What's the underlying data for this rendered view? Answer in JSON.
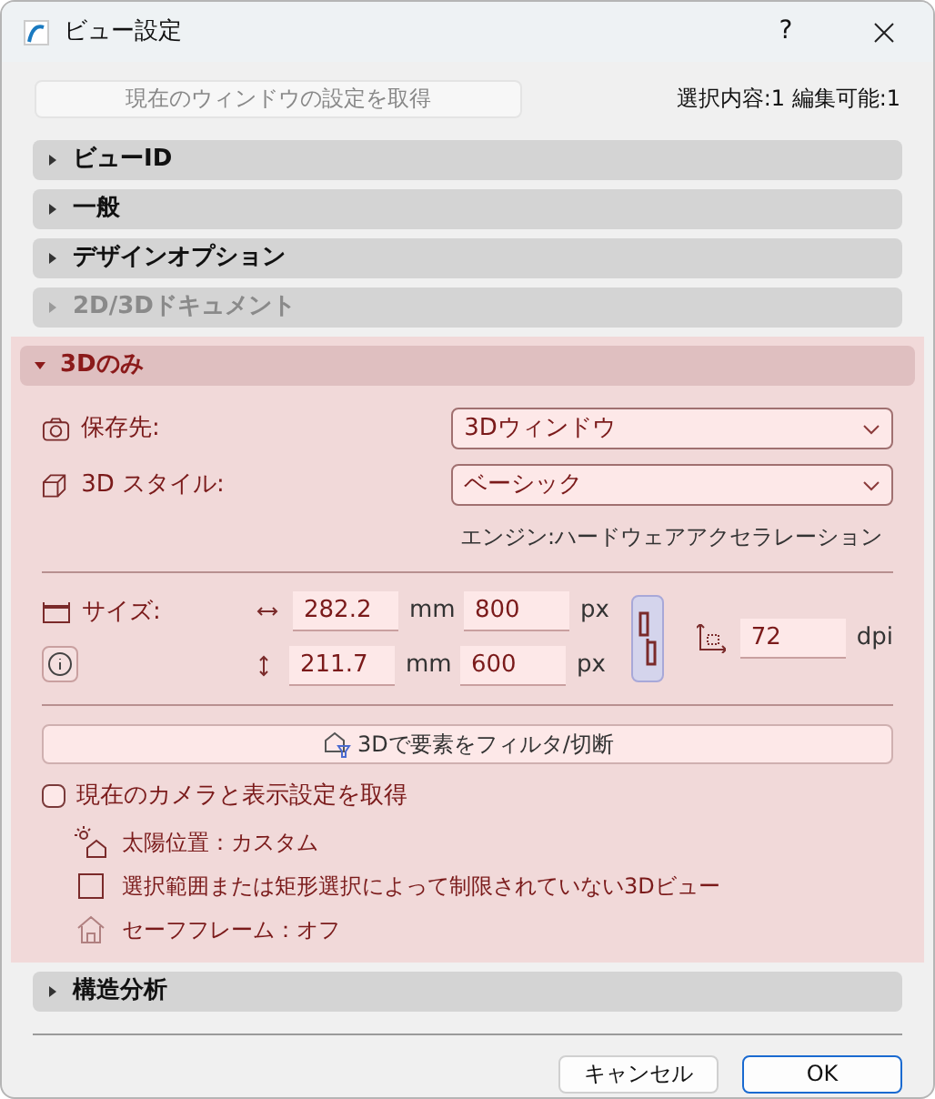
{
  "window": {
    "title": "ビュー設定",
    "help": "?"
  },
  "get_window_button": {
    "label": "現在のウィンドウの設定を取得",
    "disabled": true
  },
  "selection_info": "選択内容:1 編集可能:1",
  "sections": [
    {
      "label": "ビューID",
      "expanded": false,
      "disabled": false
    },
    {
      "label": "一般",
      "expanded": false,
      "disabled": false
    },
    {
      "label": "デザインオプション",
      "expanded": false,
      "disabled": false
    },
    {
      "label": "2D/3Dドキュメント",
      "expanded": false,
      "disabled": true
    },
    {
      "label": "3Dのみ",
      "expanded": true,
      "disabled": false,
      "content": {
        "save_to": {
          "label": "保存先:",
          "value": "3Dウィンドウ"
        },
        "style": {
          "label": "3D スタイル:",
          "value": "ベーシック"
        },
        "engine": "エンジン:ハードウェアアクセラレーション",
        "size": {
          "label": "サイズ:",
          "rows": [
            {
              "mm": "282.2",
              "mm_unit": "mm",
              "px": "800",
              "px_unit": "px"
            },
            {
              "mm": "211.7",
              "mm_unit": "mm",
              "px": "600",
              "px_unit": "px"
            }
          ],
          "linked": true,
          "dpi": "72",
          "dpi_unit": "dpi"
        },
        "filter_button": "3Dで要素をフィルタ/切断",
        "camera_checkbox": {
          "label": "現在のカメラと表示設定を取得",
          "checked": false
        },
        "info_lines": [
          {
            "kind": "sun",
            "text": "太陽位置：カスタム"
          },
          {
            "kind": "marquee",
            "text": "選択範囲または矩形選択によって制限されていない3Dビュー"
          },
          {
            "kind": "frame",
            "text": "セーフフレーム：オフ"
          }
        ]
      }
    },
    {
      "label": "構造分析",
      "expanded": false,
      "disabled": false
    }
  ],
  "buttons": [
    {
      "label": "キャンセル",
      "default": false
    },
    {
      "label": "OK",
      "default": true
    }
  ]
}
